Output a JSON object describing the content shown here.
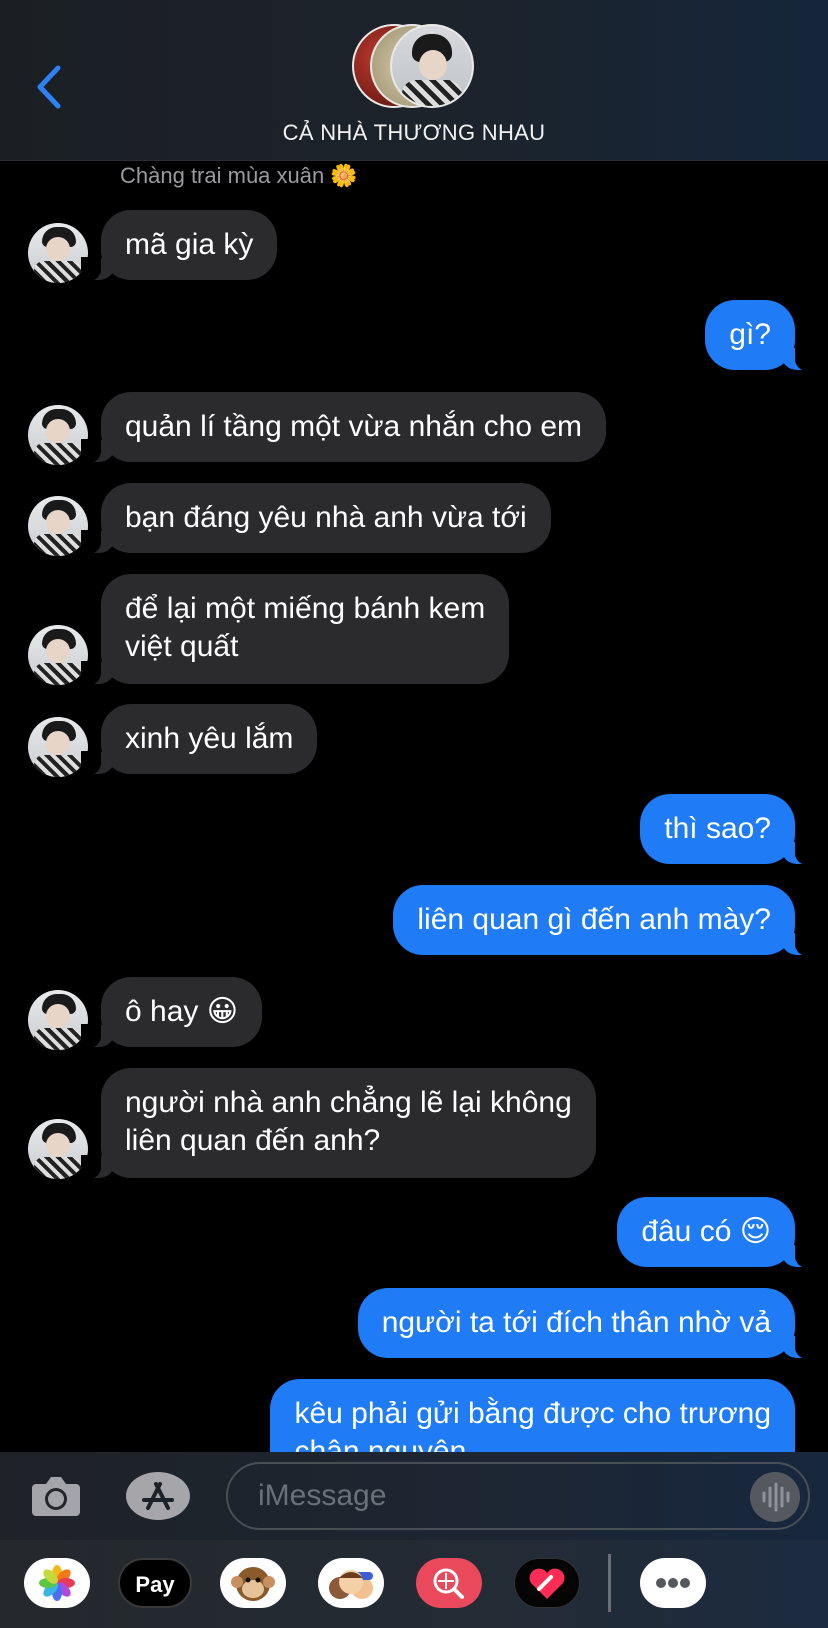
{
  "header": {
    "title": "CẢ NHÀ THƯƠNG NHAU"
  },
  "thread": {
    "sender_name": "Chàng trai mùa xuân 🌼",
    "messages": [
      {
        "direction": "incoming",
        "lines": [
          "mã gia kỳ"
        ]
      },
      {
        "direction": "outgoing",
        "lines": [
          "gì?"
        ]
      },
      {
        "direction": "incoming",
        "lines": [
          "quản lí tầng một vừa nhắn cho em"
        ]
      },
      {
        "direction": "incoming",
        "lines": [
          "bạn đáng yêu nhà anh vừa tới"
        ]
      },
      {
        "direction": "incoming",
        "lines": [
          "để lại một miếng bánh kem",
          "việt quất"
        ]
      },
      {
        "direction": "incoming",
        "lines": [
          "xinh yêu lắm"
        ]
      },
      {
        "direction": "outgoing",
        "lines": [
          "thì sao?"
        ]
      },
      {
        "direction": "outgoing",
        "lines": [
          "liên quan gì đến anh mày?"
        ]
      },
      {
        "direction": "incoming",
        "lines": [
          "ô hay 😀"
        ]
      },
      {
        "direction": "incoming",
        "lines": [
          "người nhà anh chẳng lẽ lại không",
          "liên quan đến anh?"
        ]
      },
      {
        "direction": "outgoing",
        "lines": [
          "đâu có 😌"
        ]
      },
      {
        "direction": "outgoing",
        "lines": [
          "người ta tới đích thân nhờ vả"
        ]
      },
      {
        "direction": "outgoing",
        "lines": [
          "kêu phải gửi bằng được cho trương",
          "chân nguyên"
        ]
      }
    ]
  },
  "compose": {
    "placeholder": "iMessage"
  },
  "drawer": {
    "apple_pay_label": "Pay",
    "apps": [
      "photos-icon",
      "apple-pay-icon",
      "animoji-icon",
      "memoji-icon",
      "image-search-icon",
      "digital-touch-icon",
      "more-icon"
    ]
  },
  "colors": {
    "accent": "#1f7cf6",
    "incoming_bubble": "#2b2b2d",
    "background": "#000000"
  }
}
